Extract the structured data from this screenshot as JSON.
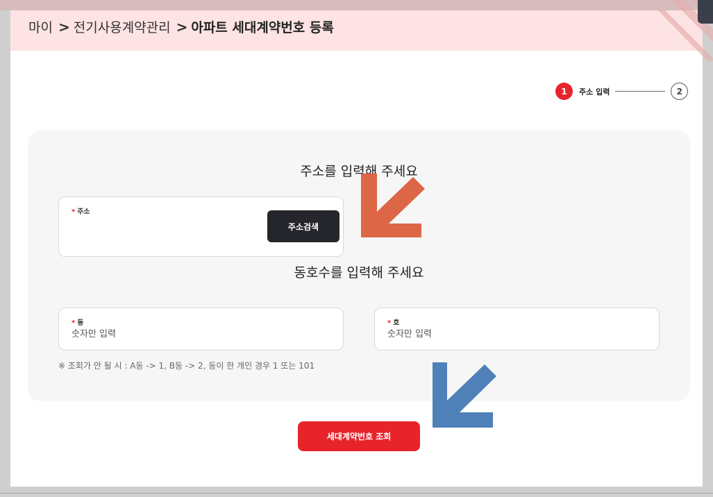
{
  "breadcrumb": {
    "items": [
      "마이",
      "전기사용계약관리"
    ],
    "current": "아파트 세대계약번호 등록",
    "separator": ">"
  },
  "stepper": {
    "step1_number": "1",
    "step1_label": "주소 입력",
    "step2_number": "2"
  },
  "address_section": {
    "title": "주소를 입력해 주세요",
    "field_label": "주소",
    "required_mark": "*",
    "search_button": "주소검색",
    "value": ""
  },
  "unit_section": {
    "title": "동호수를 입력해 주세요",
    "dong": {
      "label": "동",
      "required_mark": "*",
      "placeholder": "숫자만 입력"
    },
    "ho": {
      "label": "호",
      "required_mark": "*",
      "placeholder": "숫자만 입력"
    },
    "hint": "※ 조회가 안 될 시 : A동 -> 1, B동 -> 2, 동이 한 개인 경우 1 또는 101"
  },
  "submit_button": "세대계약번호 조회",
  "colors": {
    "accent_red": "#e8242b",
    "breadcrumb_bg": "#fde3e3",
    "dark_button": "#24262b",
    "arrow_orange": "#dc6645",
    "arrow_blue": "#4f80b8"
  },
  "icons": {
    "breadcrumb_separator": "chevron-right-icon",
    "annotation_arrow_1": "arrow-down-left-icon",
    "annotation_arrow_2": "arrow-down-left-icon"
  }
}
